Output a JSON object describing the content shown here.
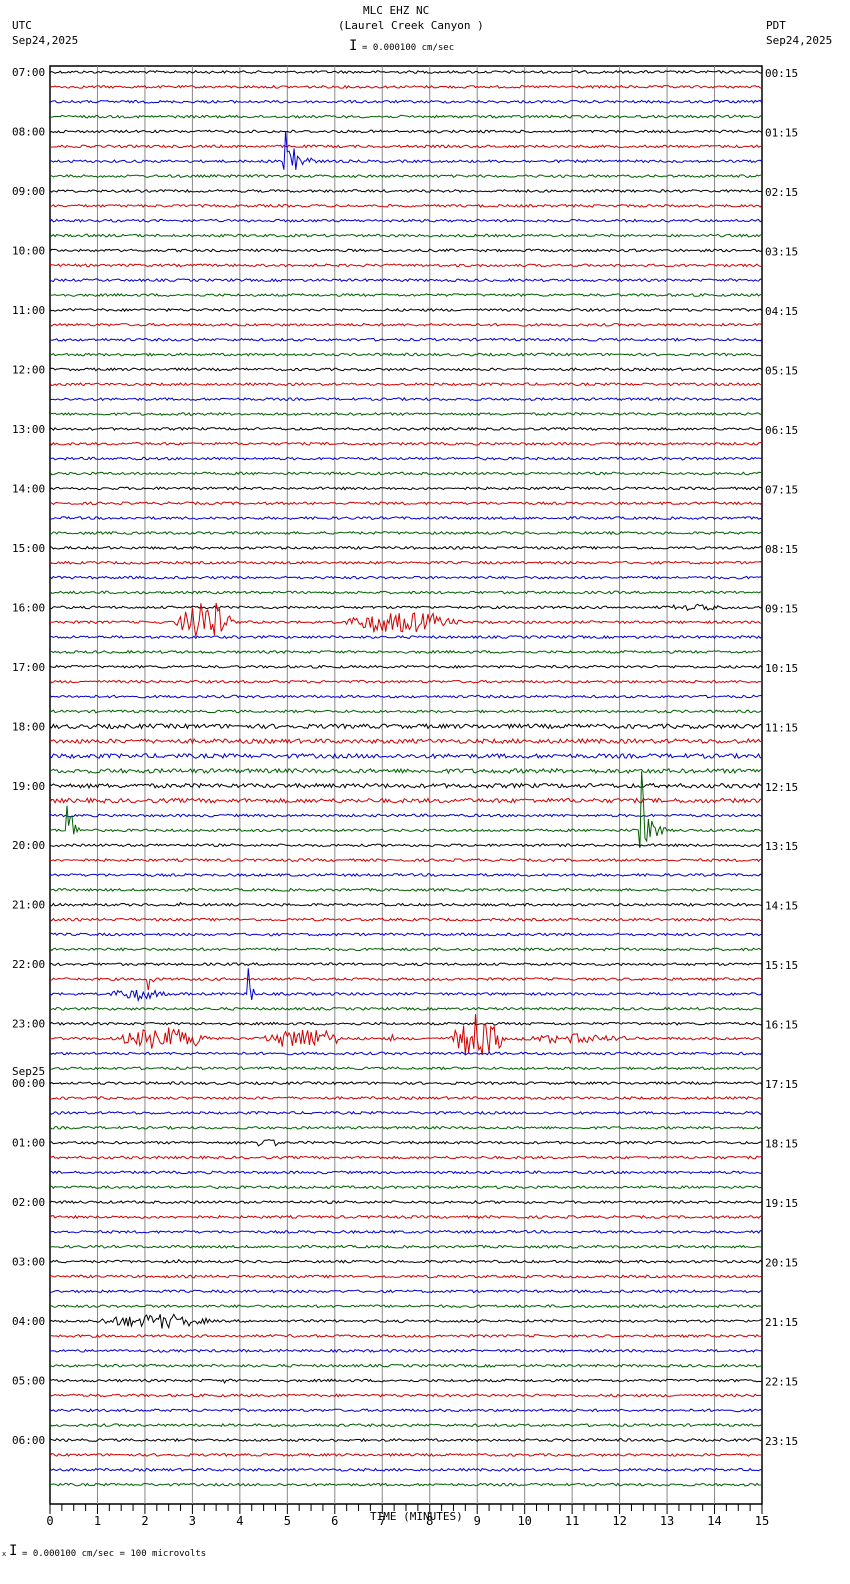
{
  "header": {
    "station": "MLC EHZ NC",
    "location": "(Laurel Creek Canyon )",
    "left_tz": "UTC",
    "left_date": "Sep24,2025",
    "right_tz": "PDT",
    "right_date": "Sep24,2025",
    "scale_text": "= 0.000100 cm/sec"
  },
  "footer": {
    "scale_text": "= 0.000100 cm/sec =     100 microvolts",
    "scale_prefix": "x"
  },
  "chart_data": {
    "type": "line",
    "title": "MLC EHZ NC (Laurel Creek Canyon )",
    "xlabel": "TIME (MINUTES)",
    "xlim": [
      0,
      15
    ],
    "x_ticks": [
      "0",
      "1",
      "2",
      "3",
      "4",
      "5",
      "6",
      "7",
      "8",
      "9",
      "10",
      "11",
      "12",
      "13",
      "14",
      "15"
    ],
    "grid": true,
    "traces_per_hour": 4,
    "trace_colors": [
      "#000000",
      "#d00000",
      "#0000d0",
      "#006000"
    ],
    "left_labels": [
      "07:00",
      "08:00",
      "09:00",
      "10:00",
      "11:00",
      "12:00",
      "13:00",
      "14:00",
      "15:00",
      "16:00",
      "17:00",
      "18:00",
      "19:00",
      "20:00",
      "21:00",
      "22:00",
      "23:00",
      "00:00",
      "01:00",
      "02:00",
      "03:00",
      "04:00",
      "05:00",
      "06:00"
    ],
    "date_change_label": "Sep25",
    "right_labels": [
      "00:15",
      "01:15",
      "02:15",
      "03:15",
      "04:15",
      "05:15",
      "06:15",
      "07:15",
      "08:15",
      "09:15",
      "10:15",
      "11:15",
      "12:15",
      "13:15",
      "14:15",
      "15:15",
      "16:15",
      "17:15",
      "18:15",
      "19:15",
      "20:15",
      "21:15",
      "22:15",
      "23:15"
    ],
    "noisy_traces": [
      44,
      45,
      46,
      47,
      48,
      49
    ],
    "events": [
      {
        "trace": 6,
        "start_min": 4.9,
        "end_min": 5.9,
        "amplitude": 65,
        "type": "quake"
      },
      {
        "trace": 37,
        "start_min": 2.6,
        "end_min": 3.9,
        "amplitude": 28,
        "type": "burst"
      },
      {
        "trace": 37,
        "start_min": 5.9,
        "end_min": 8.8,
        "amplitude": 13,
        "type": "burst"
      },
      {
        "trace": 36,
        "start_min": 12.8,
        "end_min": 14.5,
        "amplitude": 4,
        "type": "burst"
      },
      {
        "trace": 51,
        "start_min": 0.35,
        "end_min": 0.9,
        "amplitude": 45,
        "type": "quake"
      },
      {
        "trace": 51,
        "start_min": 12.4,
        "end_min": 13.2,
        "amplitude": 90,
        "type": "quake"
      },
      {
        "trace": 50,
        "start_min": 7.2,
        "end_min": 7.4,
        "amplitude": 6,
        "type": "quake"
      },
      {
        "trace": 56,
        "start_min": 2.7,
        "end_min": 2.9,
        "amplitude": 8,
        "type": "quake"
      },
      {
        "trace": 61,
        "start_min": 2.05,
        "end_min": 2.3,
        "amplitude": 40,
        "type": "quake"
      },
      {
        "trace": 62,
        "start_min": 1.0,
        "end_min": 2.6,
        "amplitude": 7,
        "type": "burst"
      },
      {
        "trace": 62,
        "start_min": 4.15,
        "end_min": 4.5,
        "amplitude": 42,
        "type": "quake"
      },
      {
        "trace": 65,
        "start_min": 1.3,
        "end_min": 3.5,
        "amplitude": 14,
        "type": "burst"
      },
      {
        "trace": 65,
        "start_min": 4.4,
        "end_min": 6.3,
        "amplitude": 14,
        "type": "burst"
      },
      {
        "trace": 65,
        "start_min": 7.15,
        "end_min": 7.35,
        "amplitude": 20,
        "type": "quake"
      },
      {
        "trace": 65,
        "start_min": 8.4,
        "end_min": 9.6,
        "amplitude": 30,
        "type": "burst"
      },
      {
        "trace": 65,
        "start_min": 9.6,
        "end_min": 12.5,
        "amplitude": 6,
        "type": "burst"
      },
      {
        "trace": 72,
        "start_min": 4.2,
        "end_min": 4.9,
        "amplitude": 6,
        "type": "burst"
      },
      {
        "trace": 84,
        "start_min": 0.8,
        "end_min": 3.6,
        "amplitude": 9,
        "type": "burst"
      },
      {
        "trace": 88,
        "start_min": 3.65,
        "end_min": 3.8,
        "amplitude": 8,
        "type": "quake"
      },
      {
        "trace": 80,
        "start_min": 2.7,
        "end_min": 2.8,
        "amplitude": 5,
        "type": "quake"
      }
    ]
  }
}
